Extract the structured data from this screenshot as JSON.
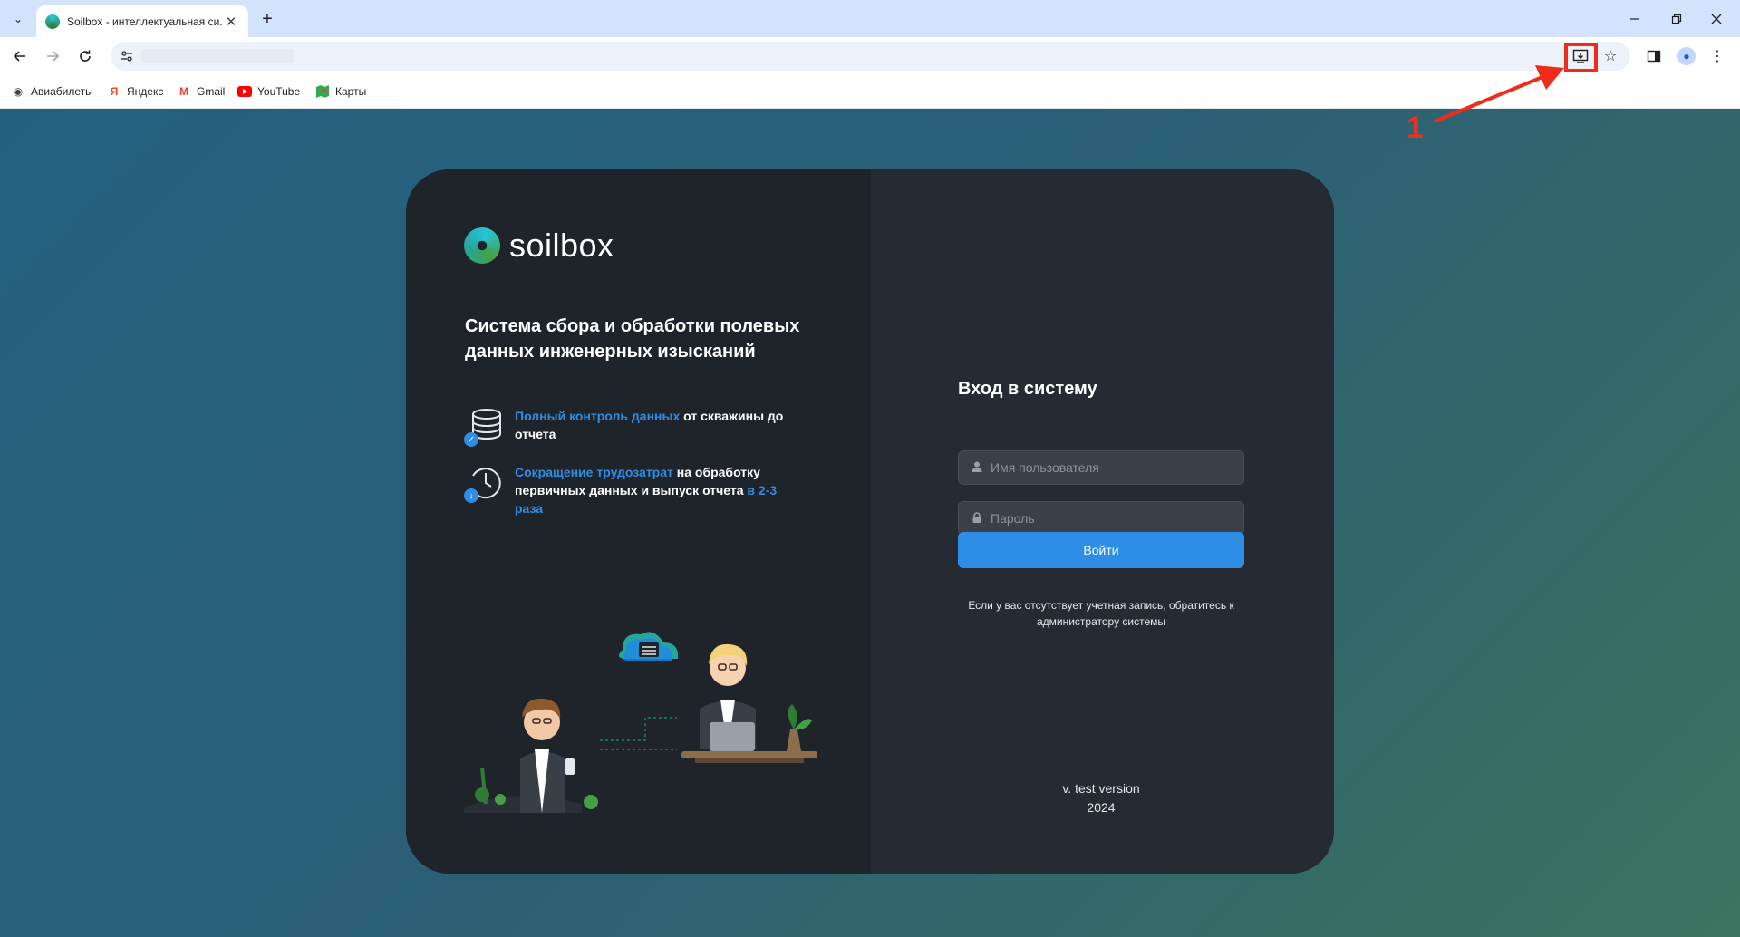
{
  "browser": {
    "tab_title": "Soilbox - интеллектуальная си...",
    "tab_close": "✕",
    "new_tab": "+",
    "bookmarks": [
      {
        "label": "Авиабилеты",
        "icon": "globe-icon"
      },
      {
        "label": "Яндекс",
        "icon": "yandex-icon"
      },
      {
        "label": "Gmail",
        "icon": "gmail-icon"
      },
      {
        "label": "YouTube",
        "icon": "youtube-icon"
      },
      {
        "label": "Карты",
        "icon": "maps-icon"
      }
    ]
  },
  "login_page": {
    "brand": "soilbox",
    "tagline": "Система сбора и обработки полевых данных инженерных изысканий",
    "features": [
      {
        "accent": "Полный контроль данных",
        "text": " от скважины до отчета",
        "tail": ""
      },
      {
        "accent": "Сокращение трудозатрат",
        "text": " на обработку первичных данных и выпуск отчета ",
        "tail": "в 2-3 раза"
      }
    ],
    "form_title": "Вход в систему",
    "username_placeholder": "Имя пользователя",
    "password_placeholder": "Пароль",
    "submit_label": "Войти",
    "hint": "Если у вас отсутствует учетная запись, обратитесь к администратору системы",
    "version": "v. test version",
    "year": "2024"
  },
  "annotation": {
    "label": "1",
    "color": "#ef2b1c"
  },
  "colors": {
    "accent": "#2f8de4",
    "button": "#2c8fe5",
    "card_left": "#1f232a",
    "card_right": "#262b33"
  }
}
